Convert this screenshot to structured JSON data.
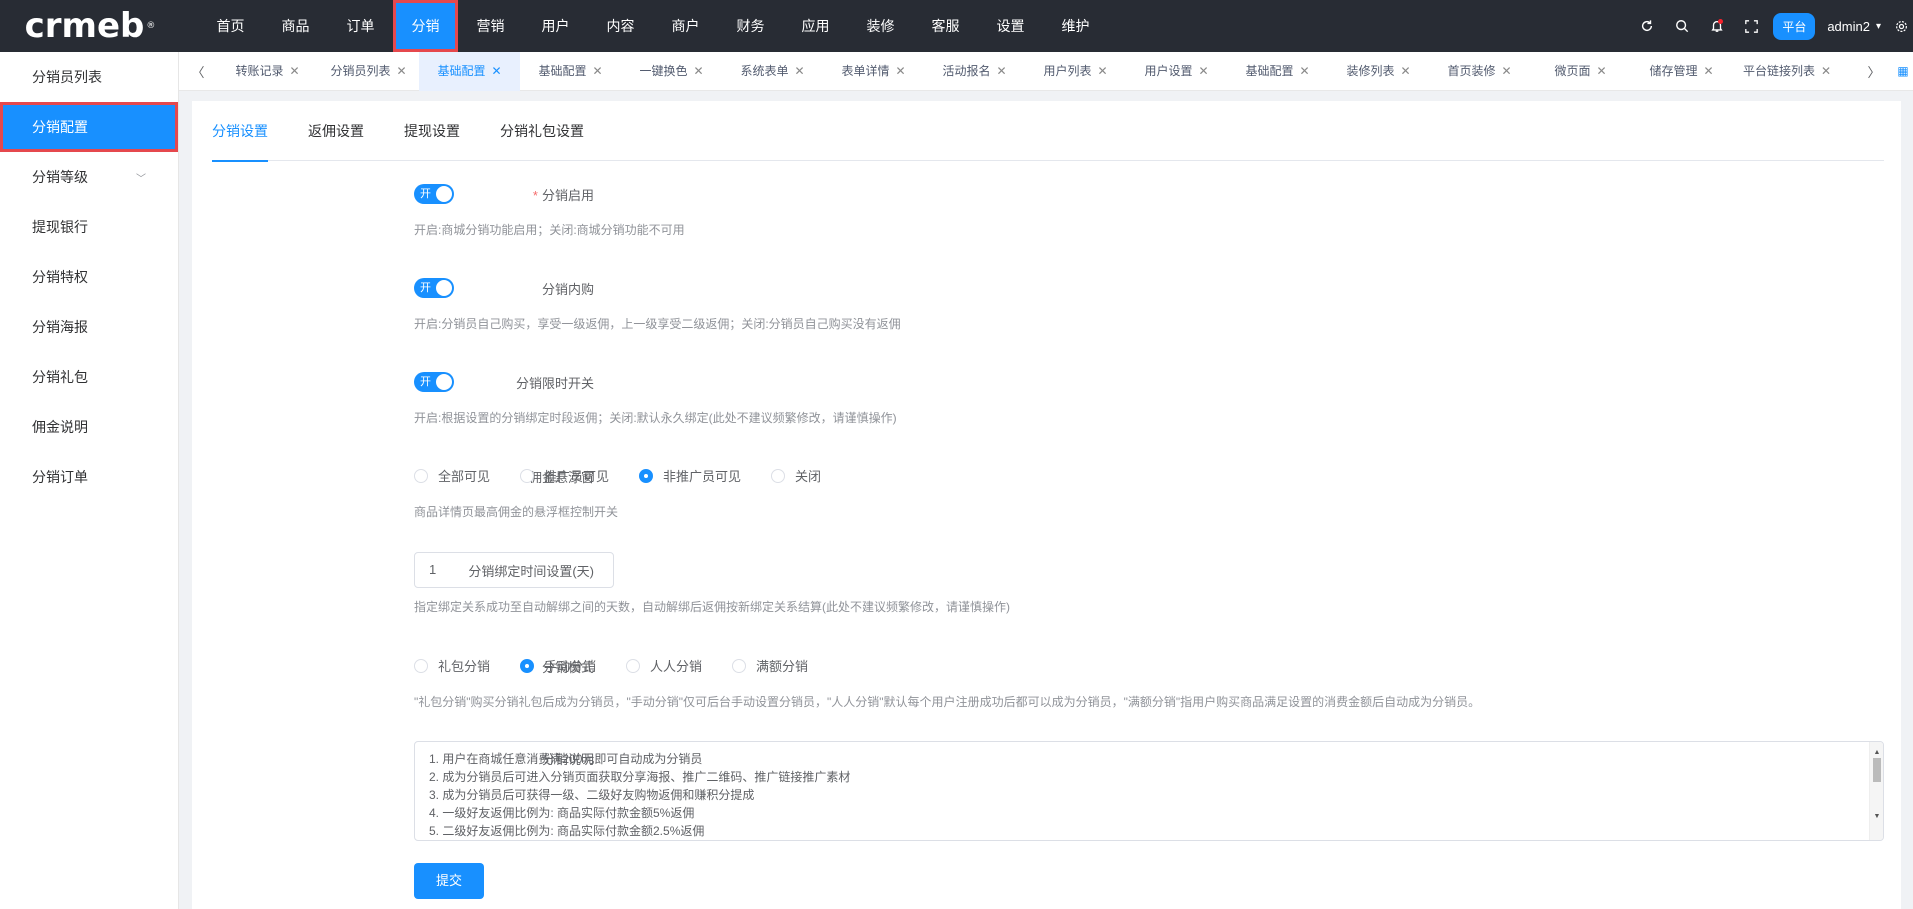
{
  "logo": {
    "text": "crmeb",
    "mark": "®"
  },
  "nav": [
    {
      "label": "首页"
    },
    {
      "label": "商品"
    },
    {
      "label": "订单"
    },
    {
      "label": "分销"
    },
    {
      "label": "营销"
    },
    {
      "label": "用户"
    },
    {
      "label": "内容"
    },
    {
      "label": "商户"
    },
    {
      "label": "财务"
    },
    {
      "label": "应用"
    },
    {
      "label": "装修"
    },
    {
      "label": "客服"
    },
    {
      "label": "设置"
    },
    {
      "label": "维护"
    }
  ],
  "nav_active_index": 3,
  "topbar": {
    "platform": "平台",
    "user": "admin2"
  },
  "sidebar": {
    "items": [
      {
        "label": "分销员列表"
      },
      {
        "label": "分销配置"
      },
      {
        "label": "分销等级"
      },
      {
        "label": "提现银行"
      },
      {
        "label": "分销特权"
      },
      {
        "label": "分销海报"
      },
      {
        "label": "分销礼包"
      },
      {
        "label": "佣金说明"
      },
      {
        "label": "分销订单"
      }
    ],
    "active_index": 1
  },
  "tabs": [
    {
      "label": "转账记录"
    },
    {
      "label": "分销员列表"
    },
    {
      "label": "基础配置"
    },
    {
      "label": "基础配置"
    },
    {
      "label": "一键换色"
    },
    {
      "label": "系统表单"
    },
    {
      "label": "表单详情"
    },
    {
      "label": "活动报名"
    },
    {
      "label": "用户列表"
    },
    {
      "label": "用户设置"
    },
    {
      "label": "基础配置"
    },
    {
      "label": "装修列表"
    },
    {
      "label": "首页装修"
    },
    {
      "label": "微页面"
    },
    {
      "label": "储存管理"
    },
    {
      "label": "平台链接列表"
    }
  ],
  "tabs_active_index": 2,
  "subtabs": [
    {
      "label": "分销设置"
    },
    {
      "label": "返佣设置"
    },
    {
      "label": "提现设置"
    },
    {
      "label": "分销礼包设置"
    }
  ],
  "form": {
    "enable": {
      "label": "分销启用",
      "required": "*",
      "switch_text": "开",
      "on": true,
      "hint": "开启:商城分销功能启用；关闭:商城分销功能不可用"
    },
    "self_buy": {
      "label": "分销内购",
      "switch_text": "开",
      "on": true,
      "hint": "开启:分销员自己购买，享受一级返佣，上一级享受二级返佣；关闭:分销员自己购买没有返佣"
    },
    "time_limit": {
      "label": "分销限时开关",
      "switch_text": "开",
      "on": true,
      "hint": "开启:根据设置的分销绑定时段返佣；关闭:默认永久绑定(此处不建议频繁修改，请谨慎操作)"
    },
    "float_window": {
      "label": "佣金悬浮窗",
      "options": [
        "全部可见",
        "推广员可见",
        "非推广员可见",
        "关闭"
      ],
      "selected": 2,
      "hint": "商品详情页最高佣金的悬浮框控制开关"
    },
    "bind_days": {
      "label": "分销绑定时间设置(天)",
      "value": "1",
      "hint": "指定绑定关系成功至自动解绑之间的天数，自动解绑后返佣按新绑定关系结算(此处不建议频繁修改，请谨慎操作)"
    },
    "mode": {
      "label": "分销模式",
      "options": [
        "礼包分销",
        "手动分销",
        "人人分销",
        "满额分销"
      ],
      "selected": 1,
      "hint": "\"礼包分销\"购买分销礼包后成为分销员，\"手动分销\"仅可后台手动设置分销员，\"人人分销\"默认每个用户注册成功后都可以成为分销员，\"满额分销\"指用户购买商品满足设置的消费金额后自动成为分销员。"
    },
    "description": {
      "label": "分销说明",
      "lines": [
        "1. 用户在商城任意消费满200元即可自动成为分销员",
        "2. 成为分销员后可进入分销页面获取分享海报、推广二维码、推广链接推广素材",
        "3. 成为分销员后可获得一级、二级好友购物返佣和赚积分提成",
        "4. 一级好友返佣比例为: 商品实际付款金额5%返佣",
        "5. 二级好友返佣比例为: 商品实际付款金额2.5%返佣"
      ]
    },
    "submit": "提交"
  },
  "colors": {
    "primary": "#1890ff",
    "topbar": "#282c34",
    "highlight": "#e5484d"
  }
}
